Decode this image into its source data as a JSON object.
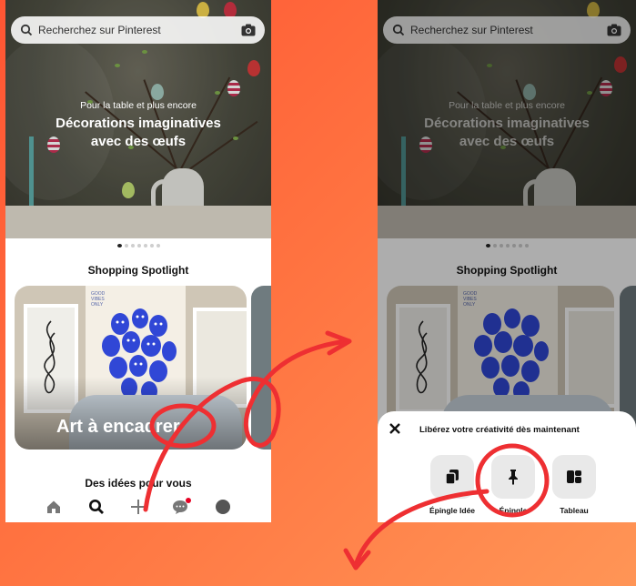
{
  "search": {
    "placeholder": "Recherchez sur Pinterest"
  },
  "hero": {
    "subtitle": "Pour la table et plus encore",
    "title_line1": "Décorations imaginatives",
    "title_line2": "avec des œufs"
  },
  "spotlight": {
    "title": "Shopping Spotlight",
    "card_label": "Art à encadrer",
    "poster_text": [
      "GOOD",
      "VIBES",
      "ONLY"
    ]
  },
  "ideas": {
    "title": "Des idées pour vous"
  },
  "carousel": {
    "total": 7,
    "active": 1
  },
  "nav": {
    "items": [
      "home-icon",
      "search-icon",
      "plus-icon",
      "chat-icon",
      "avatar"
    ]
  },
  "sheet": {
    "title": "Libérez votre créativité dès maintenant",
    "options": [
      "Épingle Idée",
      "Épingle",
      "Tableau"
    ]
  },
  "colors": {
    "background_start": "#ff5533",
    "background_end": "#ff9556",
    "annotation": "#ee2f32",
    "notification": "#e60023",
    "blob": "#3047d6"
  }
}
